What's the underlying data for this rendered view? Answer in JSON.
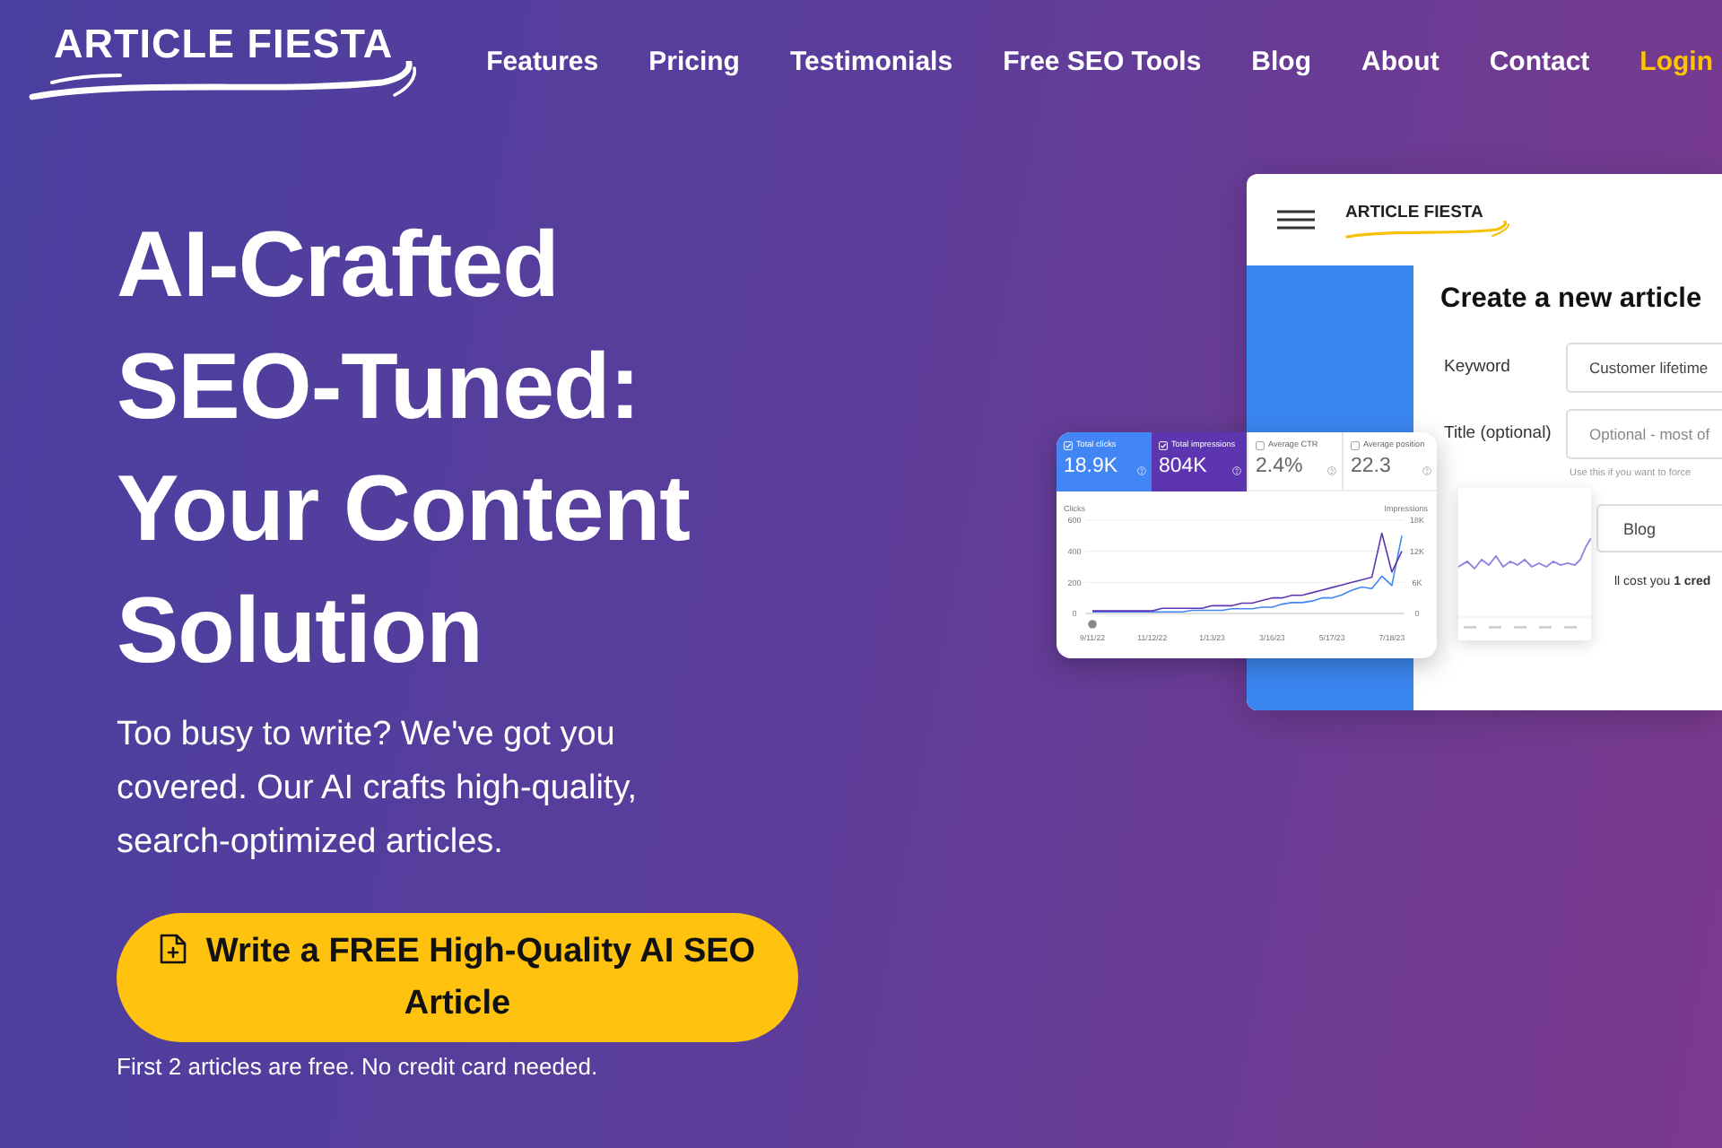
{
  "header": {
    "logo": "ARTICLE FIESTA",
    "nav": [
      {
        "label": "Features",
        "kind": "link"
      },
      {
        "label": "Pricing",
        "kind": "link"
      },
      {
        "label": "Testimonials",
        "kind": "link"
      },
      {
        "label": "Free SEO Tools",
        "kind": "link"
      },
      {
        "label": "Blog",
        "kind": "link"
      },
      {
        "label": "About",
        "kind": "link"
      },
      {
        "label": "Contact",
        "kind": "link"
      },
      {
        "label": "Login",
        "kind": "login"
      }
    ]
  },
  "hero": {
    "title": "AI-Crafted SEO-Tuned: Your Content Solution",
    "subtitle": "Too busy to write? We've got you covered. Our AI crafts high-quality, search-optimized articles.",
    "cta": "Write a FREE High-Quality AI SEO Article",
    "note": "First 2 articles are free. No credit card needed."
  },
  "mockup": {
    "logo": "ARTICLE FIESTA",
    "heading": "Create a new article",
    "fields": [
      {
        "label": "Keyword",
        "value": "Customer lifetime"
      },
      {
        "label": "Title (optional)",
        "placeholder": "Optional - most of",
        "hint": "Use this if you want to force"
      },
      {
        "value": "Blog"
      }
    ],
    "cost_note": "ll cost you **1 cred**"
  },
  "gsc_card": {
    "metrics": [
      {
        "label": "Total clicks",
        "value": "18.9K",
        "checked": true,
        "color": "#4285f4"
      },
      {
        "label": "Total impressions",
        "value": "804K",
        "checked": true,
        "color": "#5e35b1"
      },
      {
        "label": "Average CTR",
        "value": "2.4%",
        "checked": false
      },
      {
        "label": "Average position",
        "value": "22.3",
        "checked": false
      }
    ],
    "chart_data": {
      "type": "line",
      "ylabel": "Clicks",
      "y2label": "Impressions",
      "categories": [
        "9/11/22",
        null,
        null,
        null,
        null,
        null,
        "11/12/22",
        null,
        null,
        null,
        null,
        null,
        "1/13/23",
        null,
        null,
        null,
        null,
        null,
        "3/16/23",
        null,
        null,
        null,
        null,
        null,
        "5/17/23",
        null,
        null,
        null,
        null,
        null,
        "7/18/23",
        null
      ],
      "ylim": [
        0,
        600
      ],
      "y2lim": [
        0,
        18000
      ],
      "yticks": [
        0,
        200,
        400,
        600
      ],
      "y2ticks": [
        {
          "value": 0,
          "label": "0"
        },
        {
          "value": 6000,
          "label": "6K"
        },
        {
          "value": 12000,
          "label": "12K"
        },
        {
          "value": 18000,
          "label": "18K"
        }
      ],
      "series": [
        {
          "color": "#4285f4",
          "values": [
            10,
            10,
            10,
            10,
            10,
            10,
            10,
            10,
            10,
            10,
            20,
            20,
            20,
            20,
            30,
            30,
            30,
            40,
            40,
            60,
            70,
            70,
            80,
            100,
            100,
            120,
            150,
            170,
            160,
            240,
            180,
            500
          ]
        },
        {
          "color": "#5e35b1",
          "axis": "y2",
          "values": [
            500,
            500,
            500,
            500,
            500,
            500,
            500,
            1000,
            1000,
            1000,
            1000,
            1000,
            1500,
            1500,
            1500,
            2000,
            2000,
            2500,
            3000,
            3000,
            3500,
            3500,
            4000,
            4500,
            5000,
            5500,
            6000,
            6500,
            7000,
            15500,
            8000,
            12000
          ]
        }
      ]
    }
  }
}
